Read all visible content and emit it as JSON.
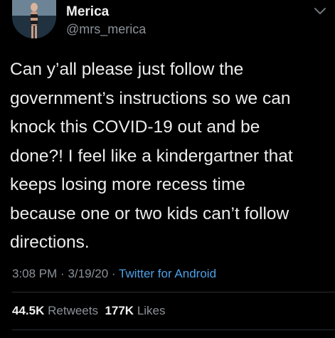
{
  "author": {
    "display_name": "Merica",
    "handle": "@mrs_merica"
  },
  "tweet": {
    "lines": [
      "Can y’all please just follow the",
      "government’s instructions so we can",
      "knock this COVID-19 out and be",
      "done?! I feel like a kindergartner that",
      "keeps losing more recess time",
      "because one or two kids can’t follow",
      "directions."
    ]
  },
  "meta": {
    "time": "3:08 PM",
    "separator": "·",
    "date": "3/19/20",
    "source": "Twitter for Android"
  },
  "stats": {
    "retweets_count": "44.5K",
    "retweets_label": "Retweets",
    "likes_count": "177K",
    "likes_label": "Likes"
  },
  "icons": {
    "menu": "chevron-down-icon"
  },
  "colors": {
    "background": "#000000",
    "text": "#ececec",
    "secondary": "#8b9298",
    "link": "#4ea1e8"
  }
}
